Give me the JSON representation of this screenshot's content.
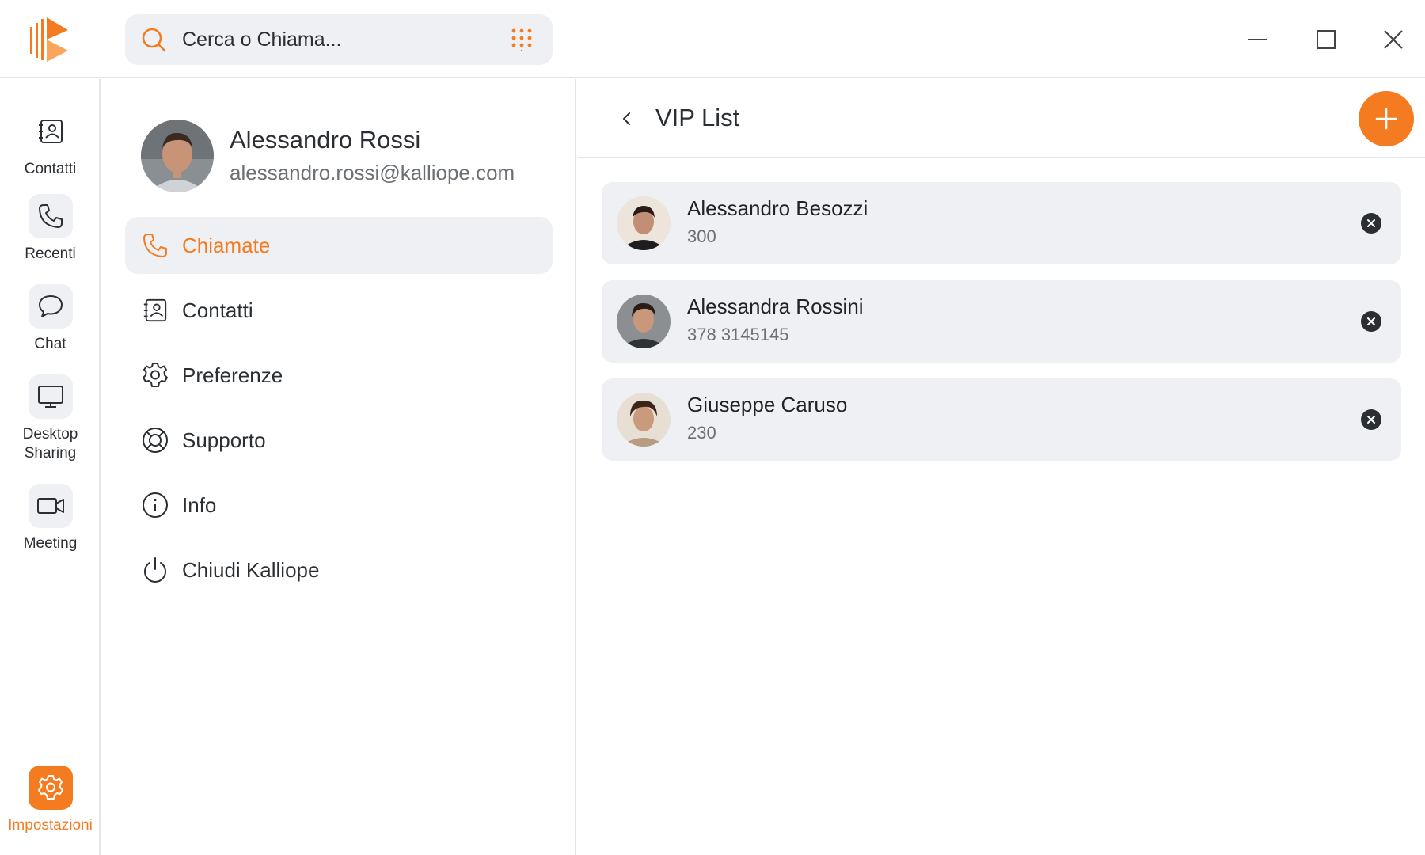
{
  "search": {
    "placeholder": "Cerca o Chiama..."
  },
  "window_controls": [
    "minimize-icon",
    "maximize-icon",
    "close-icon"
  ],
  "rail": {
    "items": [
      {
        "label": "Contatti",
        "icon": "address-book-icon"
      },
      {
        "label": "Recenti",
        "icon": "phone-icon"
      },
      {
        "label": "Chat",
        "icon": "chat-bubble-icon"
      },
      {
        "label": "Desktop Sharing",
        "icon": "monitor-icon"
      },
      {
        "label": "Meeting",
        "icon": "video-camera-icon"
      }
    ],
    "settings_label": "Impostazioni"
  },
  "profile": {
    "name": "Alessandro Rossi",
    "email": "alessandro.rossi@kalliope.com"
  },
  "menu": {
    "items": [
      {
        "label": "Chiamate",
        "icon": "phone-icon",
        "active": true
      },
      {
        "label": "Contatti",
        "icon": "address-book-icon"
      },
      {
        "label": "Preferenze",
        "icon": "gear-icon"
      },
      {
        "label": "Supporto",
        "icon": "lifebuoy-icon"
      },
      {
        "label": "Info",
        "icon": "info-icon"
      },
      {
        "label": "Chiudi Kalliope",
        "icon": "power-icon"
      }
    ]
  },
  "main": {
    "title": "VIP List",
    "vip": [
      {
        "name": "Alessandro Besozzi",
        "number": "300"
      },
      {
        "name": "Alessandra Rossini",
        "number": "378 3145145"
      },
      {
        "name": "Giuseppe Caruso",
        "number": "230"
      }
    ]
  },
  "colors": {
    "accent": "#f47b20",
    "surface": "#eef0f3",
    "divider": "#e3e5e8",
    "text": "#2b2f33",
    "muted": "#6b7075"
  }
}
